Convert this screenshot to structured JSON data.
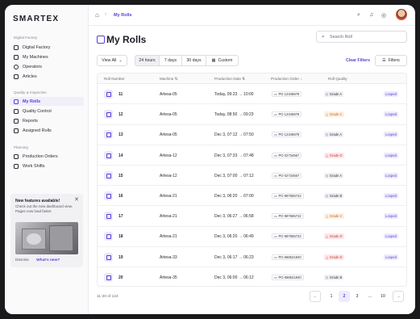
{
  "app": {
    "logo": "SMARTEX"
  },
  "sidebar": {
    "sections": [
      {
        "title": "Digital Factory",
        "items": [
          "Digital Factory",
          "My Machines",
          "Operators",
          "Articles"
        ]
      },
      {
        "title": "Quality & Inspection",
        "items": [
          "My Rolls",
          "Quality Control",
          "Reports",
          "Assigned Rolls"
        ]
      },
      {
        "title": "Planning",
        "items": [
          "Production Orders",
          "Work Shifts"
        ]
      }
    ],
    "active": "My Rolls",
    "promo": {
      "title": "New features available!",
      "text": "Check out the new dashboard view. Pages now load faster.",
      "dismiss": "Dismiss",
      "whats_new": "What's new?"
    }
  },
  "header": {
    "breadcrumb_current": "My Rolls"
  },
  "page": {
    "title": "My Rolls",
    "search_placeholder": "Search Roll"
  },
  "toolbar": {
    "view": "View All",
    "ranges": [
      "24 hours",
      "7 days",
      "30 days"
    ],
    "custom": "Custom",
    "clear": "Clear Filters",
    "filters": "Filters"
  },
  "table": {
    "columns": [
      "Roll Number",
      "Machine",
      "Production Date",
      "Production Order",
      "Roll Quality"
    ],
    "rows": [
      {
        "roll": "11",
        "machine": "Artesa-05",
        "date": "Today, 09:23 → 10:00",
        "po": "PO 12345678",
        "grade": "Grade A",
        "g": "a",
        "status": "Looped"
      },
      {
        "roll": "12",
        "machine": "Artesa-05",
        "date": "Today, 08:50 → 09:23",
        "po": "PO 12345678",
        "grade": "Grade C",
        "g": "c",
        "status": "Looped"
      },
      {
        "roll": "13",
        "machine": "Artesa-05",
        "date": "Dec 3, 07:12 → 07:50",
        "po": "PO 12345678",
        "grade": "Grade A",
        "g": "a",
        "status": "Looped"
      },
      {
        "roll": "14",
        "machine": "Artesa-12",
        "date": "Dec 3, 07:33 → 07:48",
        "po": "PO 02734567",
        "grade": "Grade D",
        "g": "d",
        "status": "Looped"
      },
      {
        "roll": "15",
        "machine": "Artesa-12",
        "date": "Dec 3, 07:00 → 07:12",
        "po": "PO 02734567",
        "grade": "Grade A",
        "g": "a",
        "status": "Looped"
      },
      {
        "roll": "16",
        "machine": "Artesa-21",
        "date": "Dec 3, 06:20 → 07:00",
        "po": "PO 987655722",
        "grade": "Grade B",
        "g": "b",
        "status": "Looped"
      },
      {
        "roll": "17",
        "machine": "Artesa-21",
        "date": "Dec 3, 06:27 → 06:58",
        "po": "PO 987655722",
        "grade": "Grade C",
        "g": "c",
        "status": "Looped"
      },
      {
        "roll": "18",
        "machine": "Artesa-21",
        "date": "Dec 3, 06:20 → 06:49",
        "po": "PO 987655722",
        "grade": "Grade D",
        "g": "d",
        "status": "Looped"
      },
      {
        "roll": "19",
        "machine": "Artesa-33",
        "date": "Dec 3, 06:17 → 06:23",
        "po": "PO 666521840",
        "grade": "Grade D",
        "g": "d",
        "status": "Looped"
      },
      {
        "roll": "20",
        "machine": "Artesa-35",
        "date": "Dec 3, 06:00 → 06:12",
        "po": "PO 666521840",
        "grade": "Grade B",
        "g": "b",
        "status": ""
      }
    ]
  },
  "pagination": {
    "count": "11-20 of 124",
    "pages": [
      "1",
      "2",
      "3",
      "...",
      "10"
    ],
    "current": "2"
  },
  "colors": {
    "accent": "#5a3fd6",
    "accent_bg": "#efeafd"
  }
}
